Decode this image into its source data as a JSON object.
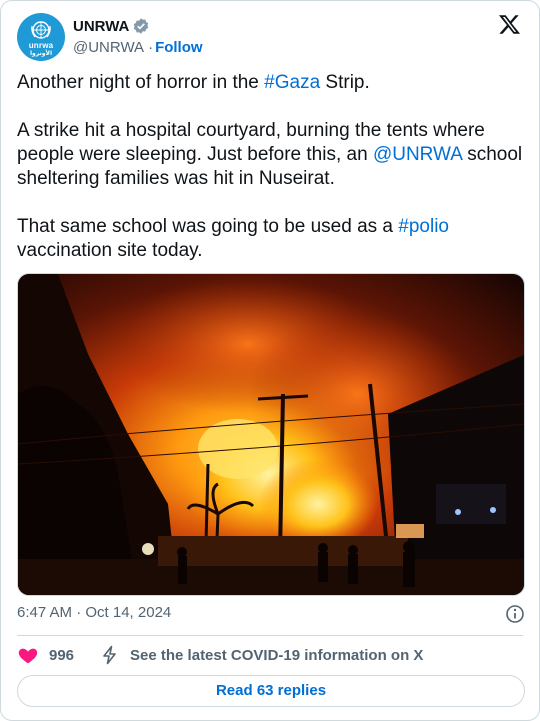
{
  "author": {
    "name": "UNRWA",
    "handle": "@UNRWA",
    "separator": "·",
    "follow_label": "Follow",
    "avatar_logo_en": "unrwa",
    "avatar_logo_ar": "الأونروا",
    "verified": true
  },
  "tweet": {
    "p1_a": "Another night of horror in the ",
    "p1_hashtag": "#Gaza",
    "p1_b": " Strip.",
    "p2_a": "A strike hit a hospital courtyard, burning the tents where people were sleeping. Just before this, an ",
    "p2_mention": "@UNRWA",
    "p2_b": " school sheltering families was hit in Nuseirat.",
    "p3_a": "That same school was going to be used as a ",
    "p3_hashtag": "#polio",
    "p3_b": " vaccination site today."
  },
  "meta": {
    "timestamp": "6:47 AM · Oct 14, 2024"
  },
  "actions": {
    "like_count": "996",
    "covid_label": "See the latest COVID-19 information on X"
  },
  "replies_label": "Read 63 replies",
  "icons": {
    "verified": "verified-badge-icon",
    "brand": "x-logo-icon",
    "info": "info-icon",
    "like": "heart-icon",
    "covid": "lightning-bolt-icon"
  },
  "colors": {
    "link": "#006fd6",
    "like": "#f91880",
    "secondary_text": "#536471",
    "avatar_bg": "#1f9ad6"
  }
}
